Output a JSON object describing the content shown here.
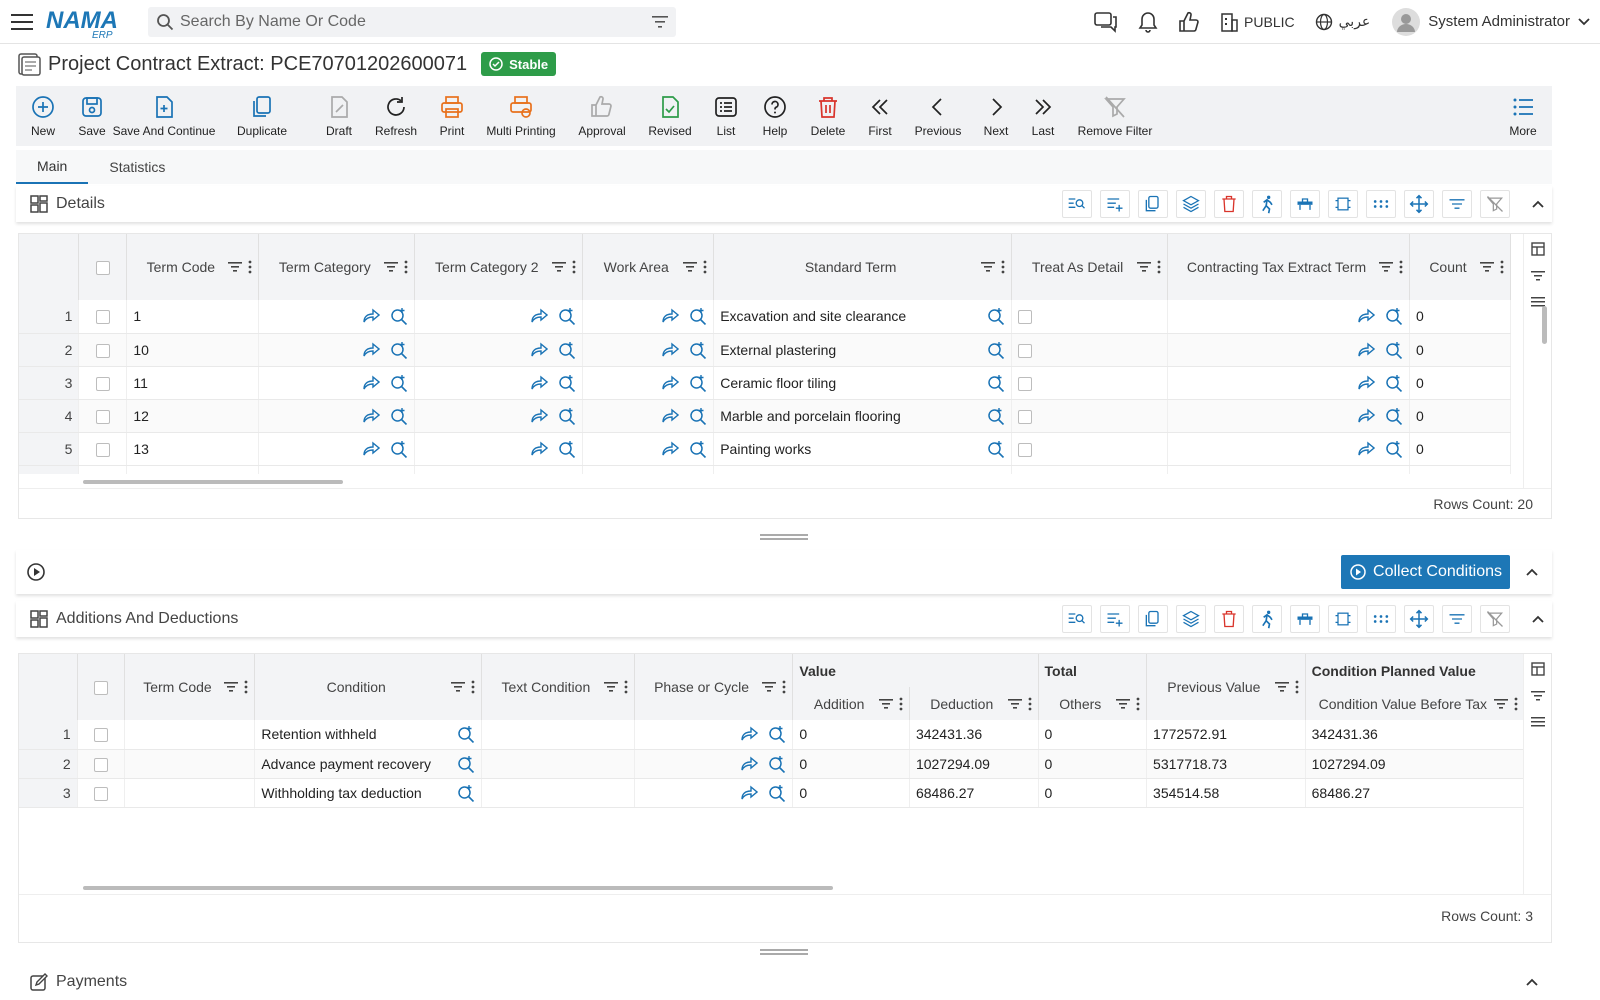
{
  "topbar": {
    "logo_text": "NAMA",
    "logo_sub": "ERP",
    "search_placeholder": "Search By Name Or Code",
    "public_label": "PUBLIC",
    "language_label": "عربي",
    "user_name": "System Administrator"
  },
  "page": {
    "title": "Project Contract Extract: PCE70701202600071",
    "status": "Stable"
  },
  "toolbar": [
    {
      "label": "New",
      "icon": "plus-circle-icon",
      "color": "#1a73b5"
    },
    {
      "label": "Save",
      "icon": "save-icon",
      "color": "#1a73b5"
    },
    {
      "label": "Save And Continue",
      "icon": "save-continue-icon",
      "color": "#1a73b5"
    },
    {
      "label": "Duplicate",
      "icon": "duplicate-icon",
      "color": "#1a73b5"
    },
    {
      "label": "Draft",
      "icon": "draft-icon",
      "color": "#aaaaaa"
    },
    {
      "label": "Refresh",
      "icon": "refresh-icon",
      "color": "#222222"
    },
    {
      "label": "Print",
      "icon": "print-icon",
      "color": "#e8711c"
    },
    {
      "label": "Multi Printing",
      "icon": "multi-print-icon",
      "color": "#e8711c"
    },
    {
      "label": "Approval",
      "icon": "thumbs-up-icon",
      "color": "#aaaaaa"
    },
    {
      "label": "Revised",
      "icon": "revised-icon",
      "color": "#2e9c49"
    },
    {
      "label": "List",
      "icon": "list-icon",
      "color": "#222222"
    },
    {
      "label": "Help",
      "icon": "help-icon",
      "color": "#222222"
    },
    {
      "label": "Delete",
      "icon": "trash-icon",
      "color": "#d9342b"
    },
    {
      "label": "First",
      "icon": "first-icon",
      "color": "#222222"
    },
    {
      "label": "Previous",
      "icon": "previous-icon",
      "color": "#222222"
    },
    {
      "label": "Next",
      "icon": "next-icon",
      "color": "#222222"
    },
    {
      "label": "Last",
      "icon": "last-icon",
      "color": "#222222"
    },
    {
      "label": "Remove Filter",
      "icon": "remove-filter-icon",
      "color": "#aaaaaa"
    },
    {
      "label": "More",
      "icon": "more-icon",
      "color": "#1a73b5"
    }
  ],
  "tabs": [
    "Main",
    "Statistics"
  ],
  "details": {
    "title": "Details",
    "columns": [
      "Term Code",
      "Term Category",
      "Term Category 2",
      "Work Area",
      "Standard Term",
      "Treat As Detail",
      "Contracting Tax Extract Term",
      "Count"
    ],
    "rows": [
      {
        "n": "1",
        "code": "1",
        "term": "Excavation and site clearance",
        "count": "0"
      },
      {
        "n": "2",
        "code": "10",
        "term": "External plastering",
        "count": "0"
      },
      {
        "n": "3",
        "code": "11",
        "term": "Ceramic floor tiling",
        "count": "0"
      },
      {
        "n": "4",
        "code": "12",
        "term": "Marble and porcelain flooring",
        "count": "0"
      },
      {
        "n": "5",
        "code": "13",
        "term": "Painting works",
        "count": "0"
      }
    ],
    "rows_count": "Rows Count: 20"
  },
  "collect_label": "Collect Conditions",
  "additions": {
    "title": "Additions And Deductions",
    "columns": {
      "term_code": "Term Code",
      "condition": "Condition",
      "text_condition": "Text Condition",
      "phase": "Phase or Cycle",
      "value_group": "Value",
      "addition": "Addition",
      "deduction": "Deduction",
      "total_group": "Total",
      "others": "Others",
      "previous": "Previous Value",
      "planned_group": "Condition Planned Value",
      "before_tax": "Condition Value Before Tax"
    },
    "rows": [
      {
        "n": "1",
        "condition": "Retention withheld",
        "addition": "0",
        "deduction": "342431.36",
        "others": "0",
        "previous": "1772572.91",
        "before_tax": "342431.36"
      },
      {
        "n": "2",
        "condition": "Advance payment recovery",
        "addition": "0",
        "deduction": "1027294.09",
        "others": "0",
        "previous": "5317718.73",
        "before_tax": "1027294.09"
      },
      {
        "n": "3",
        "condition": "Withholding tax deduction",
        "addition": "0",
        "deduction": "68486.27",
        "others": "0",
        "previous": "354514.58",
        "before_tax": "68486.27"
      }
    ],
    "rows_count": "Rows Count: 3"
  },
  "payments": {
    "title": "Payments"
  }
}
